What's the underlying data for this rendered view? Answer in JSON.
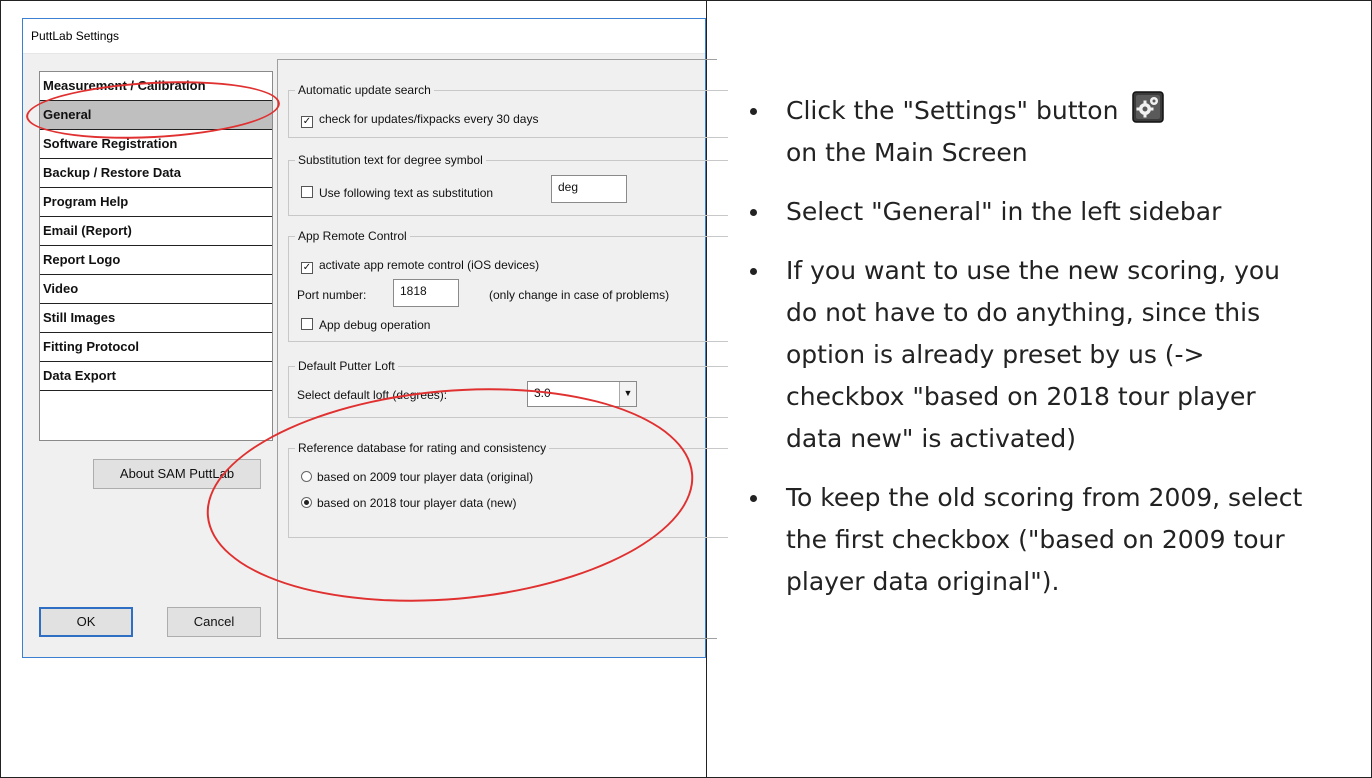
{
  "dialog": {
    "title": "PuttLab Settings",
    "nav_items": [
      {
        "label": "Measurement / Calibration"
      },
      {
        "label": "General"
      },
      {
        "label": "Software Registration"
      },
      {
        "label": "Backup / Restore Data"
      },
      {
        "label": "Program Help"
      },
      {
        "label": "Email (Report)"
      },
      {
        "label": "Report Logo"
      },
      {
        "label": "Video"
      },
      {
        "label": "Still Images"
      },
      {
        "label": "Fitting Protocol"
      },
      {
        "label": "Data Export"
      }
    ],
    "selected_nav": "General",
    "about_button": "About SAM PuttLab",
    "ok_button": "OK",
    "cancel_button": "Cancel",
    "groups": {
      "update": {
        "legend": "Automatic update search",
        "check_label": "check for updates/fixpacks every 30 days",
        "checked": true
      },
      "degree": {
        "legend": "Substitution text for degree symbol",
        "check_label": "Use following text as substitution",
        "checked": false,
        "text_value": "deg"
      },
      "remote": {
        "legend": "App Remote Control",
        "activate_label": "activate app remote control (iOS devices)",
        "activate_checked": true,
        "port_label": "Port number:",
        "port_value": "1818",
        "port_hint": "(only change in case of problems)",
        "debug_label": "App debug operation",
        "debug_checked": false
      },
      "loft": {
        "legend": "Default Putter Loft",
        "select_label": "Select default loft (degrees):",
        "select_value": "3.0"
      },
      "reference": {
        "legend": "Reference database for rating and consistency",
        "option_2009": "based on 2009 tour player data (original)",
        "option_2018": "based on 2018 tour player data (new)",
        "selected": "2018"
      }
    }
  },
  "instructions": [
    {
      "text": "Click the \"Settings\" button",
      "icon": "gear-icon",
      "text_after": "on the Main Screen"
    },
    {
      "text": "Select \"General\" in the left sidebar"
    },
    {
      "text": "If you want to use the new scoring, you do not have to do anything, since this option is already preset by us (-> checkbox \"based on 2018 tour player data new\" is activated)"
    },
    {
      "text": "To keep the old scoring from 2009, select the first checkbox (\"based on 2009 tour player data original\")."
    }
  ],
  "annotation_color": "#e03030",
  "accent_color": "#3c7fd0"
}
